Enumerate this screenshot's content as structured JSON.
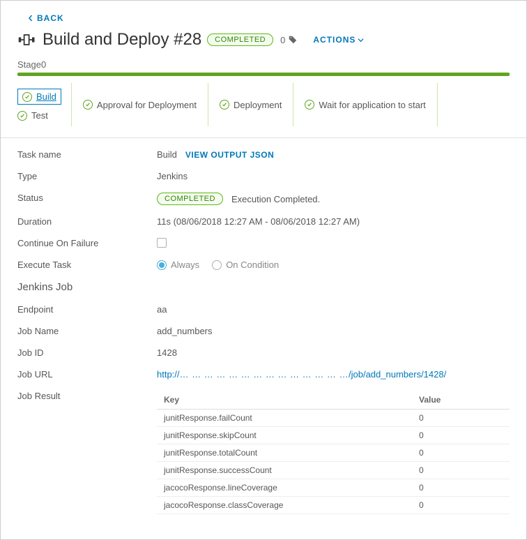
{
  "nav": {
    "back": "BACK"
  },
  "header": {
    "title": "Build and Deploy #28",
    "status": "COMPLETED",
    "tag_count": "0",
    "actions": "ACTIONS"
  },
  "stage": {
    "label": "Stage0",
    "tasks": [
      {
        "label": "Build",
        "selected": true
      },
      {
        "label": "Test"
      },
      {
        "label": "Approval for Deployment"
      },
      {
        "label": "Deployment"
      },
      {
        "label": "Wait for application to start"
      }
    ]
  },
  "details": {
    "task_name_label": "Task name",
    "task_name_value": "Build",
    "view_output": "VIEW OUTPUT JSON",
    "type_label": "Type",
    "type_value": "Jenkins",
    "status_label": "Status",
    "status_badge": "COMPLETED",
    "status_text": "Execution Completed.",
    "duration_label": "Duration",
    "duration_value": "11s (08/06/2018 12:27 AM - 08/06/2018 12:27 AM)",
    "cof_label": "Continue On Failure",
    "exec_label": "Execute Task",
    "exec_always": "Always",
    "exec_condition": "On Condition"
  },
  "jenkins": {
    "section": "Jenkins Job",
    "endpoint_label": "Endpoint",
    "endpoint_value": "aa",
    "jobname_label": "Job Name",
    "jobname_value": "add_numbers",
    "jobid_label": "Job ID",
    "jobid_value": "1428",
    "joburl_label": "Job URL",
    "joburl_prefix": "http://",
    "joburl_blur": "… … … … … … … … … … … … … …",
    "joburl_suffix": "/job/add_numbers/1428/",
    "jobresult_label": "Job Result",
    "table": {
      "key_header": "Key",
      "value_header": "Value",
      "rows": [
        {
          "k": "junitResponse.failCount",
          "v": "0"
        },
        {
          "k": "junitResponse.skipCount",
          "v": "0"
        },
        {
          "k": "junitResponse.totalCount",
          "v": "0"
        },
        {
          "k": "junitResponse.successCount",
          "v": "0"
        },
        {
          "k": "jacocoResponse.lineCoverage",
          "v": "0"
        },
        {
          "k": "jacocoResponse.classCoverage",
          "v": "0"
        }
      ]
    }
  }
}
